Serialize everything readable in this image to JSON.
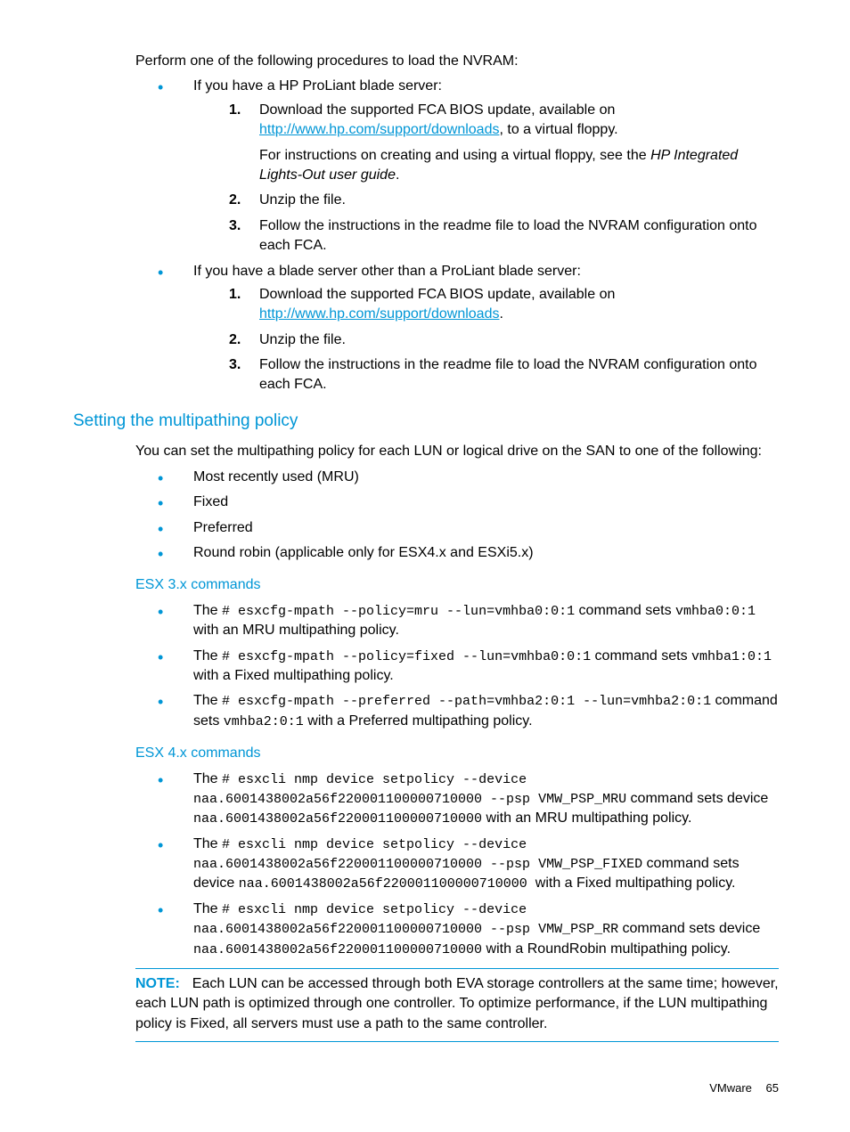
{
  "intro": "Perform one of the following procedures to load the NVRAM:",
  "b1": {
    "lead": "If you have a HP ProLiant blade server:",
    "s1a": "Download the supported FCA BIOS update, available on ",
    "s1link": "http://www.hp.com/support/downloads",
    "s1b": ", to a virtual floppy.",
    "s1c_a": "For instructions on creating and using a virtual floppy, see the ",
    "s1c_i": "HP Integrated Lights-Out user guide",
    "s1c_b": ".",
    "s2": "Unzip the file.",
    "s3": "Follow the instructions in the readme file to load the NVRAM configuration onto each FCA."
  },
  "b2": {
    "lead": "If you have a blade server other than a ProLiant blade server:",
    "s1a": "Download the supported FCA BIOS update, available on ",
    "s1link": "http://www.hp.com/support/downloads",
    "s1b": ".",
    "s2": "Unzip the file.",
    "s3": "Follow the instructions in the readme file to load the NVRAM configuration onto each FCA."
  },
  "heading": "Setting the multipathing policy",
  "mp_intro": "You can set the multipathing policy for each LUN or logical drive on the SAN to one of the following:",
  "mp_items": {
    "a": "Most recently used (MRU)",
    "b": "Fixed",
    "c": "Preferred",
    "d": "Round robin (applicable only for ESX4.x and ESXi5.x)"
  },
  "esx3_h": "ESX 3.x commands",
  "esx3": {
    "a_pre": "The ",
    "a_cmd": "# esxcfg-mpath --policy=mru --lun=vmhba0:0:1",
    "a_mid": " command sets ",
    "a_dev": "vmhba0:0:1",
    "a_post": " with an MRU multipathing policy.",
    "b_pre": "The ",
    "b_cmd": "# esxcfg-mpath --policy=fixed --lun=vmhba0:0:1",
    "b_mid": " command sets ",
    "b_dev": "vmhba1:0:1",
    "b_post": " with a Fixed multipathing policy.",
    "c_pre": "The ",
    "c_cmd": "# esxcfg-mpath --preferred --path=vmhba2:0:1 --lun=vmhba2:0:1",
    "c_mid": " command sets ",
    "c_dev": "vmhba2:0:1",
    "c_post": " with a Preferred multipathing policy."
  },
  "esx4_h": "ESX 4.x commands",
  "esx4": {
    "a_pre": "The ",
    "a_cmd": "# esxcli nmp device setpolicy --device naa.6001438002a56f220001100000710000 --psp VMW_PSP_MRU",
    "a_mid": " command sets device ",
    "a_dev": "naa.6001438002a56f220001100000710000",
    "a_post": " with an MRU multipathing policy.",
    "b_pre": "The ",
    "b_cmd": "# esxcli nmp device setpolicy --device naa.6001438002a56f220001100000710000 --psp VMW_PSP_FIXED",
    "b_mid": " command sets device ",
    "b_dev": "naa.6001438002a56f220001100000710000 ",
    "b_post": " with a Fixed multipathing policy.",
    "c_pre": "The ",
    "c_cmd": "# esxcli nmp device setpolicy --device naa.6001438002a56f220001100000710000 --psp VMW_PSP_RR",
    "c_mid": " command sets device ",
    "c_dev": "naa.6001438002a56f220001100000710000",
    "c_post": " with a RoundRobin multipathing policy."
  },
  "note_label": "NOTE:",
  "note_body": "Each LUN can be accessed through both EVA storage controllers at the same time; however, each LUN path is optimized through one controller. To optimize performance, if the LUN multipathing policy is Fixed, all servers must use a path to the same controller.",
  "footer_section": "VMware",
  "footer_page": "65"
}
